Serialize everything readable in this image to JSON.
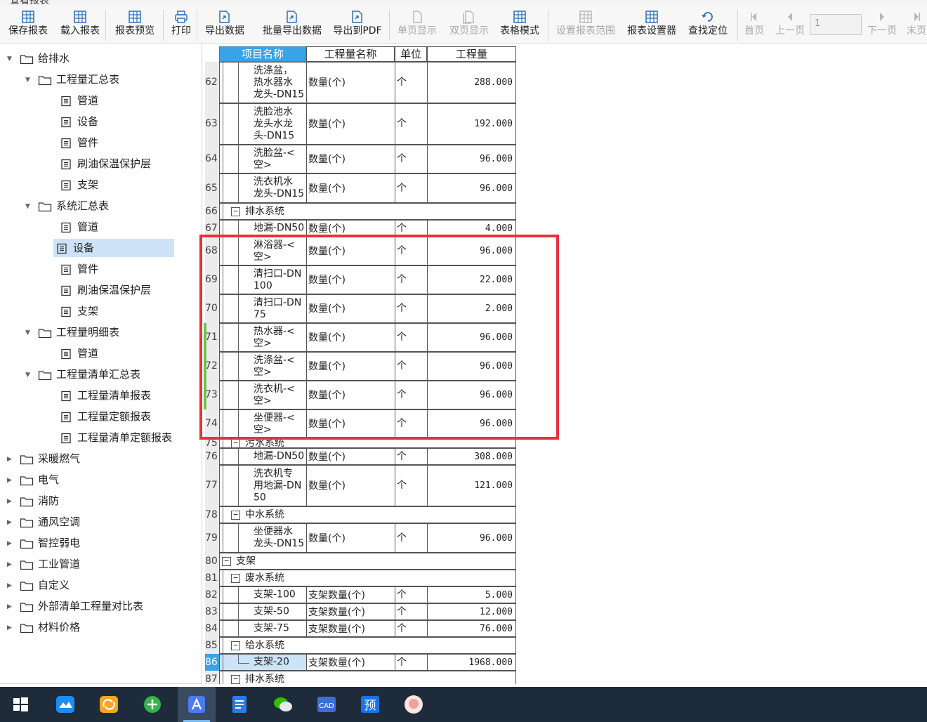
{
  "window": {
    "title": "查看报表"
  },
  "toolbar": {
    "buttons": [
      {
        "label": "保存报表",
        "icon": "save-report-icon",
        "enabled": true
      },
      {
        "label": "载入报表",
        "icon": "load-report-icon",
        "enabled": true
      },
      {
        "label": "报表预览",
        "icon": "preview-report-icon",
        "enabled": true
      },
      {
        "label": "打印",
        "icon": "print-icon",
        "enabled": true
      },
      {
        "label": "导出数据",
        "icon": "export-data-icon",
        "enabled": true
      },
      {
        "label": "批量导出数据",
        "icon": "batch-export-icon",
        "enabled": true
      },
      {
        "label": "导出到PDF",
        "icon": "export-pdf-icon",
        "enabled": true
      },
      {
        "label": "单页显示",
        "icon": "single-page-icon",
        "enabled": false
      },
      {
        "label": "双页显示",
        "icon": "double-page-icon",
        "enabled": false
      },
      {
        "label": "表格模式",
        "icon": "table-mode-icon",
        "enabled": true
      },
      {
        "label": "设置报表范围",
        "icon": "set-range-icon",
        "enabled": false
      },
      {
        "label": "报表设置器",
        "icon": "report-settings-icon",
        "enabled": true
      },
      {
        "label": "查找定位",
        "icon": "find-locate-icon",
        "enabled": true
      },
      {
        "label": "首页",
        "icon": "first-page-icon",
        "enabled": false
      },
      {
        "label": "上一页",
        "icon": "prev-page-icon",
        "enabled": false
      },
      {
        "label": "下一页",
        "icon": "next-page-icon",
        "enabled": false
      },
      {
        "label": "末页",
        "icon": "last-page-icon",
        "enabled": false
      }
    ],
    "page_input": "1"
  },
  "tree": [
    {
      "label": "给排水",
      "level": 0,
      "type": "folder",
      "expanded": true
    },
    {
      "label": "工程量汇总表",
      "level": 1,
      "type": "folder",
      "expanded": true
    },
    {
      "label": "管道",
      "level": 2,
      "type": "doc"
    },
    {
      "label": "设备",
      "level": 2,
      "type": "doc"
    },
    {
      "label": "管件",
      "level": 2,
      "type": "doc"
    },
    {
      "label": "刷油保温保护层",
      "level": 2,
      "type": "doc"
    },
    {
      "label": "支架",
      "level": 2,
      "type": "doc"
    },
    {
      "label": "系统汇总表",
      "level": 1,
      "type": "folder",
      "expanded": true
    },
    {
      "label": "管道",
      "level": 2,
      "type": "doc"
    },
    {
      "label": "设备",
      "level": 2,
      "type": "doc",
      "selected": true
    },
    {
      "label": "管件",
      "level": 2,
      "type": "doc"
    },
    {
      "label": "刷油保温保护层",
      "level": 2,
      "type": "doc"
    },
    {
      "label": "支架",
      "level": 2,
      "type": "doc"
    },
    {
      "label": "工程量明细表",
      "level": 1,
      "type": "folder",
      "expanded": true
    },
    {
      "label": "管道",
      "level": 2,
      "type": "doc"
    },
    {
      "label": "工程量清单汇总表",
      "level": 1,
      "type": "folder",
      "expanded": true
    },
    {
      "label": "工程量清单报表",
      "level": 2,
      "type": "doc"
    },
    {
      "label": "工程量定额报表",
      "level": 2,
      "type": "doc"
    },
    {
      "label": "工程量清单定额报表",
      "level": 2,
      "type": "doc"
    },
    {
      "label": "采暖燃气",
      "level": 0,
      "type": "folder",
      "expanded": false
    },
    {
      "label": "电气",
      "level": 0,
      "type": "folder",
      "expanded": false
    },
    {
      "label": "消防",
      "level": 0,
      "type": "folder",
      "expanded": false
    },
    {
      "label": "通风空调",
      "level": 0,
      "type": "folder",
      "expanded": false
    },
    {
      "label": "智控弱电",
      "level": 0,
      "type": "folder",
      "expanded": false
    },
    {
      "label": "工业管道",
      "level": 0,
      "type": "folder",
      "expanded": false
    },
    {
      "label": "自定义",
      "level": 0,
      "type": "folder",
      "expanded": false
    },
    {
      "label": "外部清单工程量对比表",
      "level": 0,
      "type": "folder",
      "expanded": false
    },
    {
      "label": "材料价格",
      "level": 0,
      "type": "folder",
      "expanded": false
    }
  ],
  "grid": {
    "headers": [
      "项目名称",
      "工程量名称",
      "单位",
      "工程量"
    ],
    "rows": [
      {
        "num": "62",
        "name": [
          "洗涤盆，",
          "热水器水",
          "龙头-DN15"
        ],
        "qty_name": "数量(个)",
        "unit": "个",
        "value": "288.000"
      },
      {
        "num": "63",
        "name": [
          "洗脸池水",
          "龙头水龙",
          "头-DN15"
        ],
        "qty_name": "数量(个)",
        "unit": "个",
        "value": "192.000"
      },
      {
        "num": "64",
        "name": [
          "洗脸盆-<",
          "空>"
        ],
        "qty_name": "数量(个)",
        "unit": "个",
        "value": "96.000"
      },
      {
        "num": "65",
        "name": [
          "洗衣机水",
          "龙头-DN15"
        ],
        "qty_name": "数量(个)",
        "unit": "个",
        "value": "96.000"
      },
      {
        "num": "66",
        "group": "排水系统",
        "group_level": 1
      },
      {
        "num": "67",
        "name": [
          "地漏-DN50"
        ],
        "qty_name": "数量(个)",
        "unit": "个",
        "value": "4.000"
      },
      {
        "num": "68",
        "name": [
          "淋浴器-<",
          "空>"
        ],
        "qty_name": "数量(个)",
        "unit": "个",
        "value": "96.000"
      },
      {
        "num": "69",
        "name": [
          "清扫口-DN",
          "100"
        ],
        "qty_name": "数量(个)",
        "unit": "个",
        "value": "22.000"
      },
      {
        "num": "70",
        "name": [
          "清扫口-DN",
          "75"
        ],
        "qty_name": "数量(个)",
        "unit": "个",
        "value": "2.000"
      },
      {
        "num": "71",
        "name": [
          "热水器-<",
          "空>"
        ],
        "qty_name": "数量(个)",
        "unit": "个",
        "value": "96.000",
        "band": true
      },
      {
        "num": "72",
        "name": [
          "洗涤盆-<",
          "空>"
        ],
        "qty_name": "数量(个)",
        "unit": "个",
        "value": "96.000",
        "band": true
      },
      {
        "num": "73",
        "name": [
          "洗衣机-<",
          "空>"
        ],
        "qty_name": "数量(个)",
        "unit": "个",
        "value": "96.000",
        "band": true
      },
      {
        "num": "74",
        "name": [
          "坐便器-<",
          "空>"
        ],
        "qty_name": "数量(个)",
        "unit": "个",
        "value": "96.000"
      },
      {
        "num": "75",
        "group": "污水系统",
        "group_level": 1
      },
      {
        "num": "76",
        "name": [
          "地漏-DN50"
        ],
        "qty_name": "数量(个)",
        "unit": "个",
        "value": "308.000"
      },
      {
        "num": "77",
        "name": [
          "洗衣机专",
          "用地漏-DN",
          "50"
        ],
        "qty_name": "数量(个)",
        "unit": "个",
        "value": "121.000"
      },
      {
        "num": "78",
        "group": "中水系统",
        "group_level": 1
      },
      {
        "num": "79",
        "name": [
          "坐便器水",
          "龙头-DN15"
        ],
        "qty_name": "数量(个)",
        "unit": "个",
        "value": "96.000"
      },
      {
        "num": "80",
        "group": "支架",
        "group_level": 0
      },
      {
        "num": "81",
        "group": "废水系统",
        "group_level": 1
      },
      {
        "num": "82",
        "name": [
          "支架-100"
        ],
        "qty_name": "支架数量(个)",
        "unit": "个",
        "value": "5.000"
      },
      {
        "num": "83",
        "name": [
          "支架-50"
        ],
        "qty_name": "支架数量(个)",
        "unit": "个",
        "value": "12.000"
      },
      {
        "num": "84",
        "name": [
          "支架-75"
        ],
        "qty_name": "支架数量(个)",
        "unit": "个",
        "value": "76.000"
      },
      {
        "num": "85",
        "group": "给水系统",
        "group_level": 1
      },
      {
        "num": "86",
        "name": [
          "支架-20"
        ],
        "qty_name": "支架数量(个)",
        "unit": "个",
        "value": "1968.000",
        "selected": true
      },
      {
        "num": "87",
        "group": "排水系统",
        "group_level": 1
      }
    ]
  },
  "taskbar": {
    "apps": [
      {
        "icon": "windows-start-icon",
        "color": "#ffffff"
      },
      {
        "icon": "cloud-app-icon",
        "color": "#1e8cf0"
      },
      {
        "icon": "sync-app-icon",
        "color": "#f5a623"
      },
      {
        "icon": "browser-icon",
        "color": "#35b34a"
      },
      {
        "icon": "report-app-icon",
        "color": "#4a7cf0",
        "active": true
      },
      {
        "icon": "document-app-icon",
        "color": "#2d7be0"
      },
      {
        "icon": "wechat-icon",
        "color": "#2dc100"
      },
      {
        "icon": "cad-app-icon",
        "color": "#3b6fd6"
      },
      {
        "icon": "budget-app-icon",
        "color": "#1b73e8"
      },
      {
        "icon": "avatar-app-icon",
        "color": "#f0a0a0"
      }
    ],
    "budget_app_glyph": "预",
    "cad_app_glyph": "CAD"
  }
}
